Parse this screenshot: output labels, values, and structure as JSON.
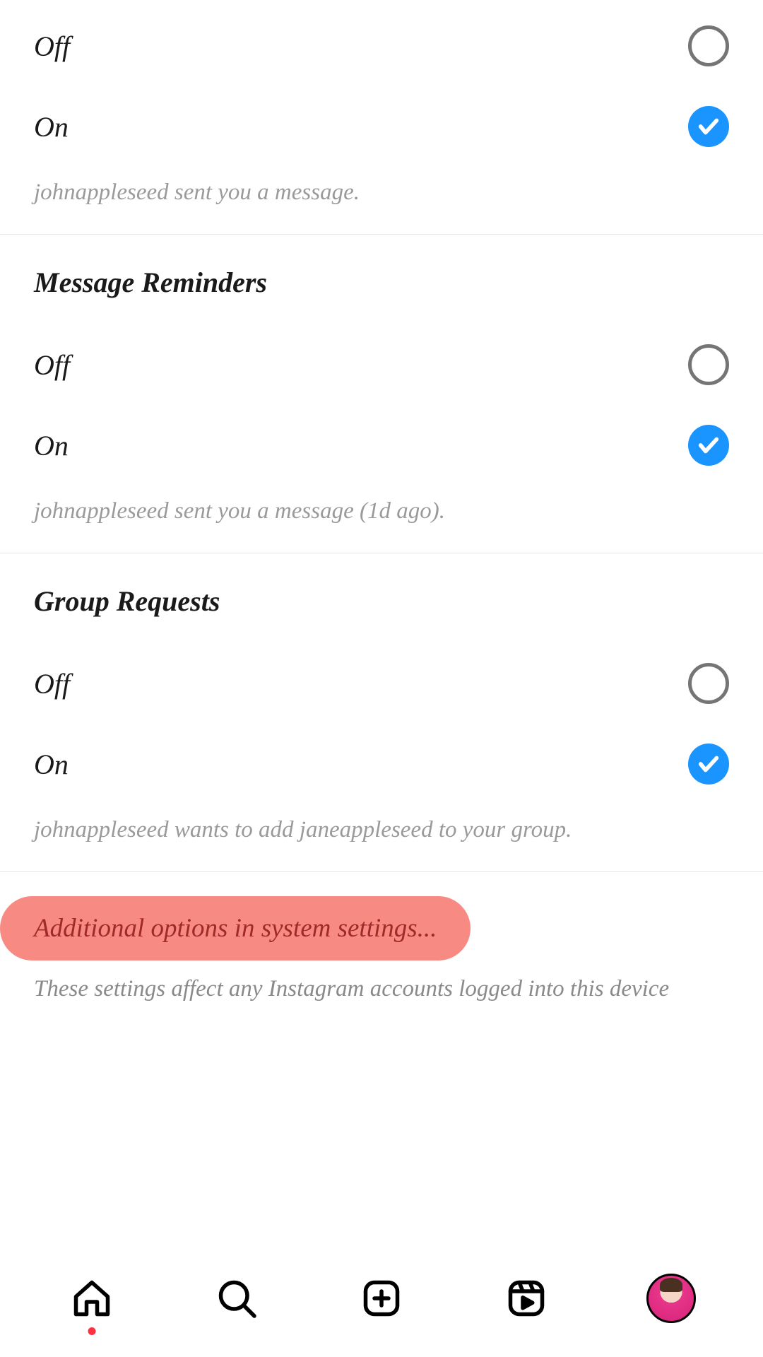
{
  "sections": [
    {
      "options": [
        {
          "label": "Off",
          "checked": false
        },
        {
          "label": "On",
          "checked": true
        }
      ],
      "example": "johnappleseed sent you a message."
    },
    {
      "title": "Message Reminders",
      "options": [
        {
          "label": "Off",
          "checked": false
        },
        {
          "label": "On",
          "checked": true
        }
      ],
      "example": "johnappleseed sent you a message (1d ago)."
    },
    {
      "title": "Group Requests",
      "options": [
        {
          "label": "Off",
          "checked": false
        },
        {
          "label": "On",
          "checked": true
        }
      ],
      "example": "johnappleseed wants to add janeappleseed to your group."
    }
  ],
  "system": {
    "link": "Additional options in system settings...",
    "note": "These settings affect any Instagram accounts logged into this device"
  }
}
